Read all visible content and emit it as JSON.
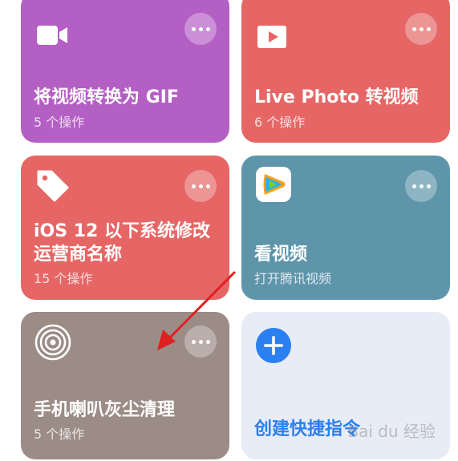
{
  "colors": {
    "purple": "#b45fc4",
    "red": "#e66666",
    "teal": "#5e95ab",
    "taupe": "#9c8c86",
    "light": "#e7ecf7",
    "blue": "#2a80f0"
  },
  "cards": [
    {
      "title": "将视频转换为 GIF",
      "subtitle": "5 个操作",
      "icon": "video-camera-icon"
    },
    {
      "title": "Live Photo 转视频",
      "subtitle": "6 个操作",
      "icon": "play-video-icon"
    },
    {
      "title_line1": "iOS 12 以下系统修改",
      "title_line2": "运营商名称",
      "subtitle": "15 个操作",
      "icon": "tag-icon"
    },
    {
      "title": "看视频",
      "subtitle": "打开腾讯视频",
      "icon": "tencent-video-logo"
    },
    {
      "title": "手机喇叭灰尘清理",
      "subtitle": "5 个操作",
      "icon": "concentric-circles-icon"
    },
    {
      "title": "创建快捷指令",
      "icon": "plus-icon"
    }
  ],
  "watermark": "Bai du 经验",
  "annotation": "red-arrow-pointer"
}
